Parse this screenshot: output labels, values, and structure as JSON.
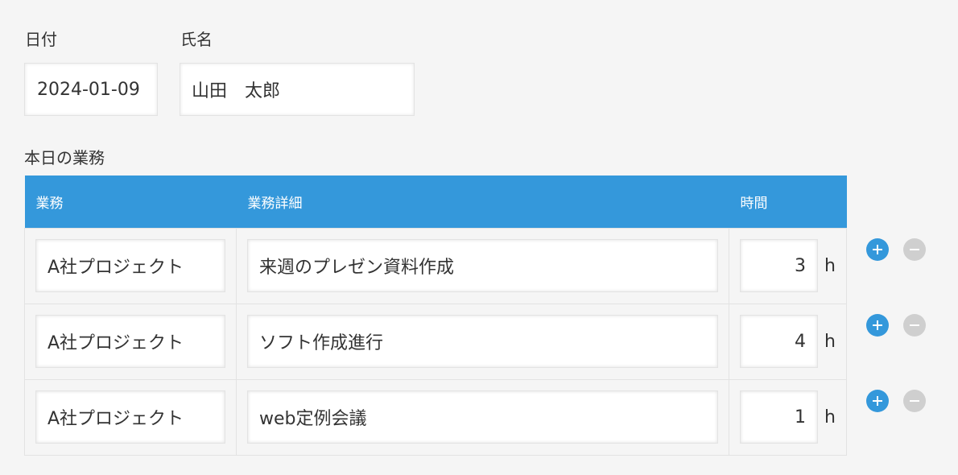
{
  "form": {
    "date_label": "日付",
    "date_value": "2024-01-09",
    "name_label": "氏名",
    "name_value": "山田　太郎",
    "section_title": "本日の業務"
  },
  "table": {
    "headers": {
      "task": "業務",
      "detail": "業務詳細",
      "time": "時間"
    },
    "unit": "h",
    "rows": [
      {
        "task": "A社プロジェクト",
        "detail": "来週のプレゼン資料作成",
        "hours": "3"
      },
      {
        "task": "A社プロジェクト",
        "detail": "ソフト作成進行",
        "hours": "4"
      },
      {
        "task": "A社プロジェクト",
        "detail": "web定例会議",
        "hours": "1"
      }
    ]
  },
  "icons": {
    "add": "plus-circle-icon",
    "remove": "minus-circle-icon"
  },
  "colors": {
    "accent": "#3498db",
    "disabled": "#cfcfcf",
    "background": "#f5f5f5"
  }
}
